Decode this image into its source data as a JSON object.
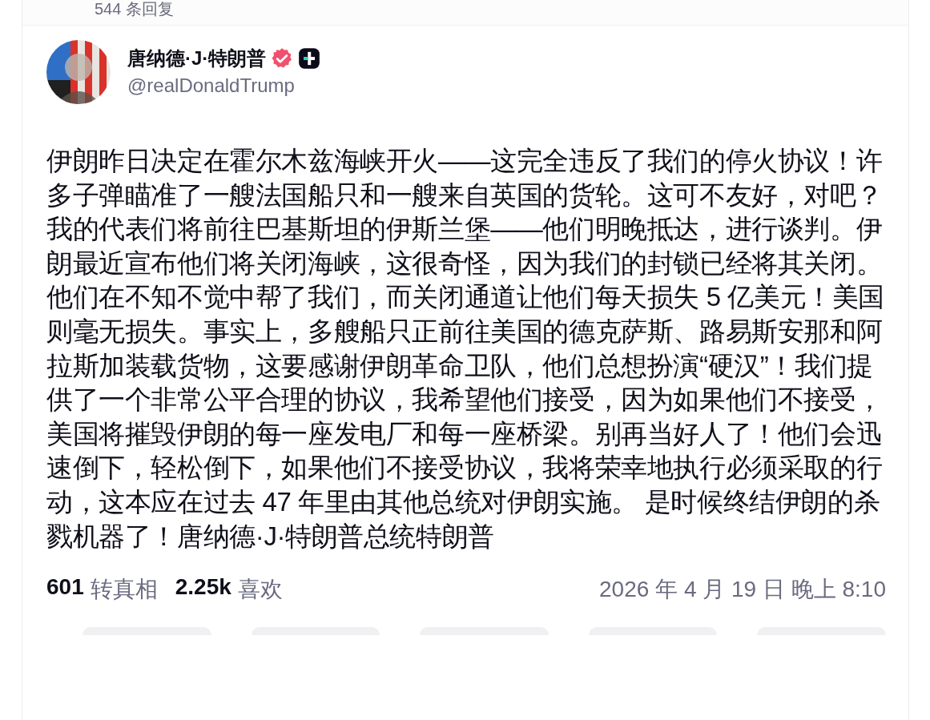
{
  "previous_post": {
    "replies": "544 条回复"
  },
  "post": {
    "author": {
      "name": "唐纳德·J·特朗普",
      "handle": "@realDonaldTrump",
      "verified": true,
      "plus_badge": true
    },
    "body": "伊朗昨日决定在霍尔木兹海峡开火——这完全违反了我们的停火协议！许多子弹瞄准了一艘法国船只和一艘来自英国的货轮。这可不友好，对吧？我的代表们将前往巴基斯坦的伊斯兰堡——他们明晚抵达，进行谈判。伊朗最近宣布他们将关闭海峡，这很奇怪，因为我们的封锁已经将其关闭。他们在不知不觉中帮了我们，而关闭通道让他们每天损失 5 亿美元！美国则毫无损失。事实上，多艘船只正前往美国的德克萨斯、路易斯安那和阿拉斯加装载货物，这要感谢伊朗革命卫队，他们总想扮演“硬汉”！我们提供了一个非常公平合理的协议，我希望他们接受，因为如果他们不接受，美国将摧毁伊朗的每一座发电厂和每一座桥梁。别再当好人了！他们会迅速倒下，轻松倒下，如果他们不接受协议，我将荣幸地执行必须采取的行动，这本应在过去 47 年里由其他总统对伊朗实施。 是时候终结伊朗的杀戮机器了！唐纳德·J·特朗普总统特朗普",
    "stats": [
      {
        "count": "601",
        "label": "转真相"
      },
      {
        "count": "2.25k",
        "label": "喜欢"
      }
    ],
    "timestamp": "2026 年 4 月 19 日 晚上 8:10",
    "actions": [
      {
        "kind": "pill"
      },
      {
        "kind": "pill"
      },
      {
        "kind": "pill"
      },
      {
        "kind": "pill"
      },
      {
        "kind": "pill"
      }
    ]
  }
}
